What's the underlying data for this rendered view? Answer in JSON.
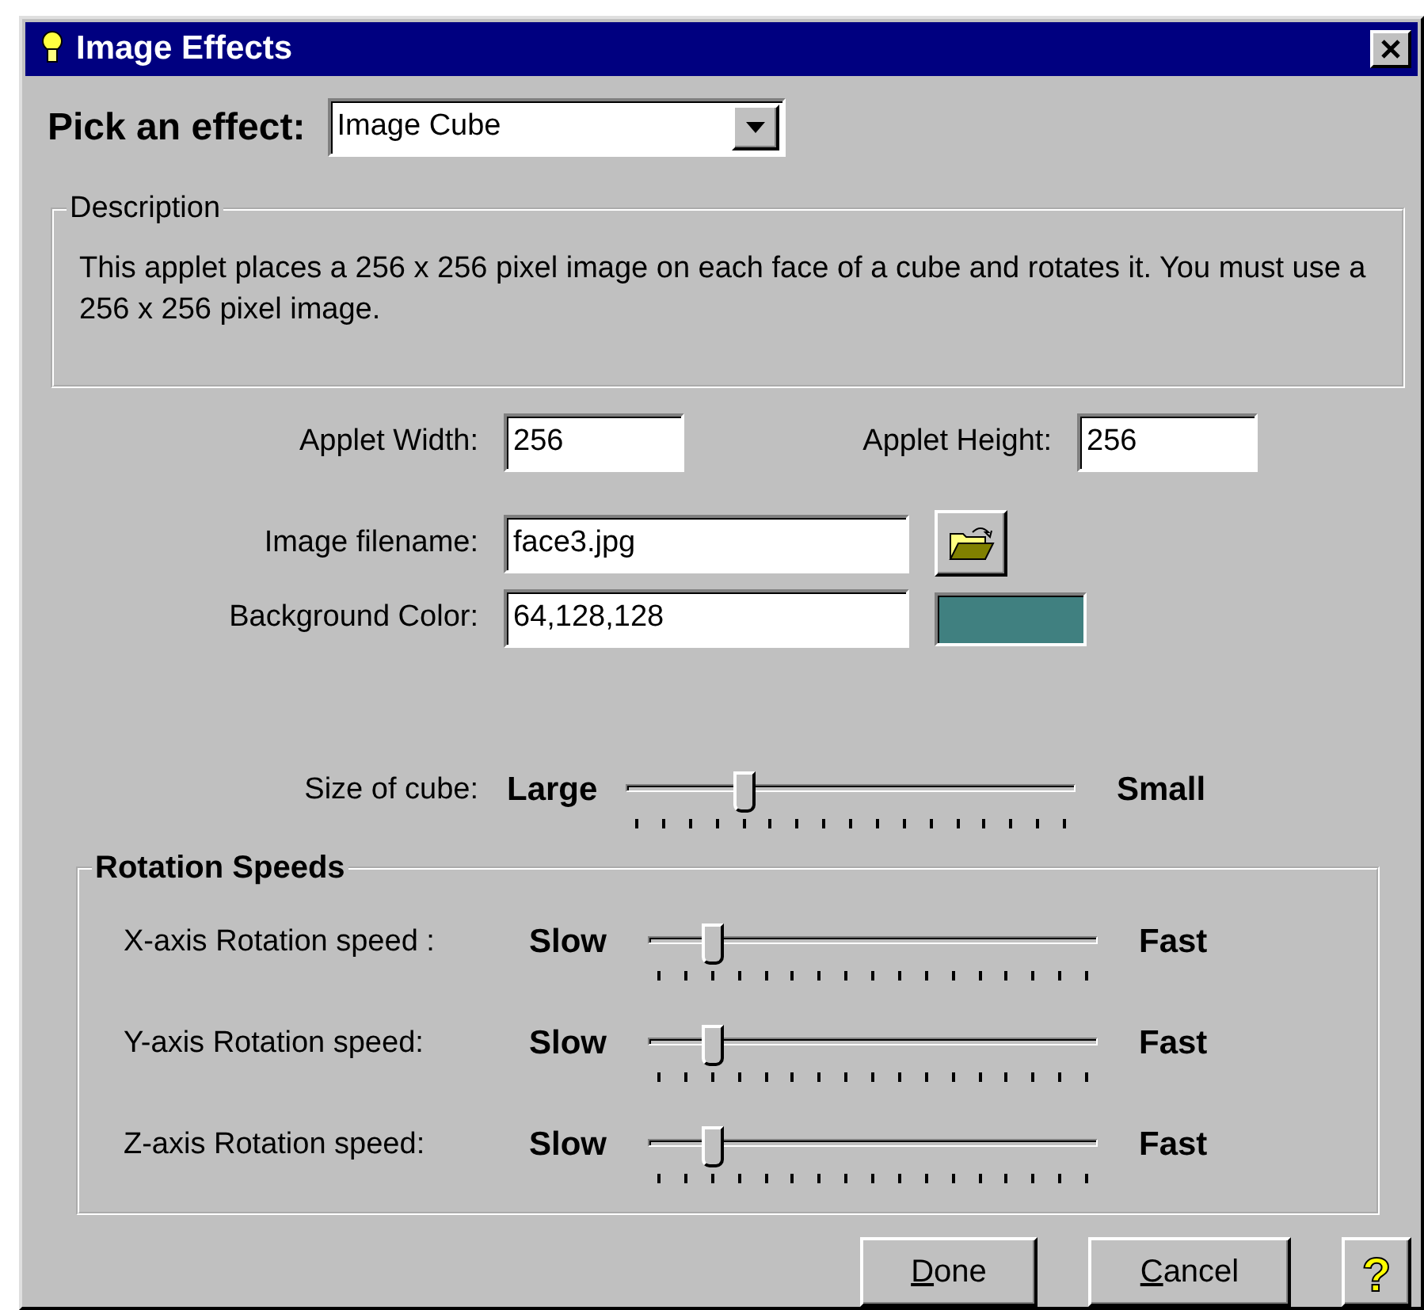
{
  "window": {
    "title": "Image Effects"
  },
  "effect": {
    "label": "Pick an effect:",
    "value": "Image Cube"
  },
  "description": {
    "title": "Description",
    "text": "This applet places a 256 x 256 pixel image on each face of a cube and rotates it.  You must use a 256 x 256 pixel image."
  },
  "width": {
    "label": "Applet Width:",
    "value": "256"
  },
  "height": {
    "label": "Applet Height:",
    "value": "256"
  },
  "image_filename": {
    "label": "Image filename:",
    "value": "face3.jpg"
  },
  "background_color": {
    "label": "Background Color:",
    "value": "64,128,128",
    "color": "#408080"
  },
  "size_of_cube": {
    "label": "Size of cube:",
    "min_label": "Large",
    "max_label": "Small",
    "level": 0.25
  },
  "rotation_speeds": {
    "title": "Rotation Speeds",
    "sliders": [
      {
        "label": "X-axis Rotation speed :",
        "min_label": "Slow",
        "max_label": "Fast",
        "level": 0.125
      },
      {
        "label": "Y-axis Rotation speed:",
        "min_label": "Slow",
        "max_label": "Fast",
        "level": 0.125
      },
      {
        "label": "Z-axis Rotation speed:",
        "min_label": "Slow",
        "max_label": "Fast",
        "level": 0.125
      }
    ]
  },
  "buttons": [
    {
      "label": "Done",
      "kind": "text",
      "mnemonic_underlined": true
    },
    {
      "label": "Cancel",
      "kind": "text",
      "mnemonic_underlined": true
    },
    {
      "label": "?",
      "kind": "help"
    }
  ]
}
